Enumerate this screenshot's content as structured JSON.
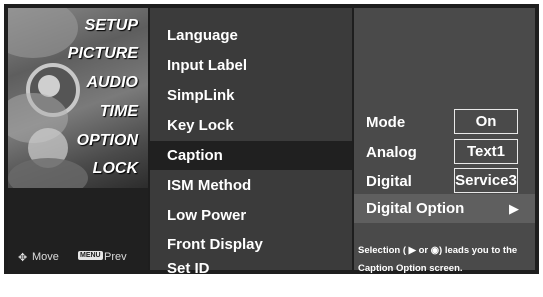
{
  "categories": [
    {
      "label": "SETUP"
    },
    {
      "label": "PICTURE"
    },
    {
      "label": "AUDIO"
    },
    {
      "label": "TIME"
    },
    {
      "label": "OPTION"
    },
    {
      "label": "LOCK"
    }
  ],
  "active_category": "OPTION",
  "footer": {
    "move_icon": "dpad-icon",
    "move_label": "Move",
    "menu_key": "MENU",
    "prev_label": "Prev"
  },
  "options": [
    {
      "label": "Language"
    },
    {
      "label": "Input Label"
    },
    {
      "label": "SimpLink"
    },
    {
      "label": "Key Lock"
    },
    {
      "label": "Caption"
    },
    {
      "label": "ISM Method"
    },
    {
      "label": "Low Power"
    },
    {
      "label": "Front Display"
    },
    {
      "label": "Set ID"
    }
  ],
  "selected_option": "Caption",
  "caption_settings": {
    "mode": {
      "label": "Mode",
      "value": "On"
    },
    "analog": {
      "label": "Analog",
      "value": "Text1"
    },
    "digital": {
      "label": "Digital",
      "value": "Service3"
    },
    "digital_option": {
      "label": "Digital Option",
      "arrow": "▶"
    }
  },
  "help": {
    "line1": "Selection ( ▶ or ◉) leads you to the",
    "line2": "Caption Option screen."
  },
  "colors": {
    "background": "#1e1e1e",
    "selected_row": "#202020",
    "highlight_row": "#5f5f5f",
    "text": "#ffffff"
  }
}
